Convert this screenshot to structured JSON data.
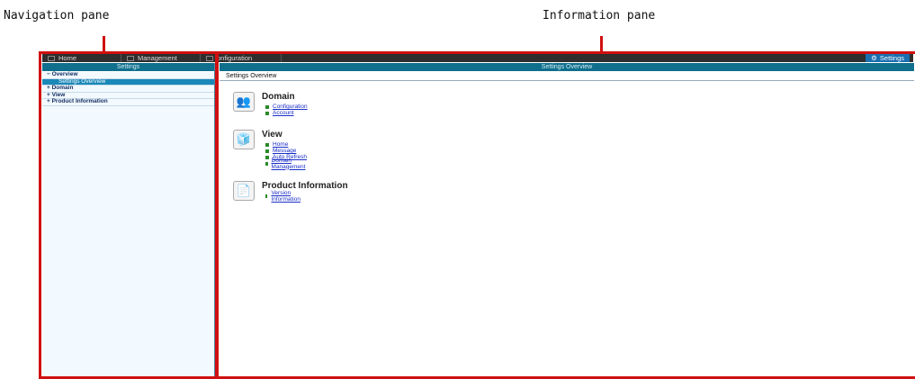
{
  "callouts": {
    "navigation_pane": "Navigation pane",
    "information_pane": "Information pane"
  },
  "topbar": {
    "tabs": [
      {
        "label": "Home",
        "icon": "home-icon"
      },
      {
        "label": "Management",
        "icon": "management-icon"
      },
      {
        "label": "onfiguration",
        "icon": "configuration-icon"
      }
    ],
    "settings_tab": "Settings"
  },
  "nav": {
    "header": "Settings",
    "tree": [
      {
        "label": "− Overview"
      },
      {
        "label": "Settings Overview",
        "selected": true
      },
      {
        "label": "+ Domain"
      },
      {
        "label": "+ View"
      },
      {
        "label": "+ Product Information"
      }
    ]
  },
  "info": {
    "header": "Settings Overview",
    "breadcrumb": "Settings Overview",
    "sections": [
      {
        "title": "Domain",
        "icon": "domain-icon",
        "links": [
          "Configuration",
          "Account"
        ]
      },
      {
        "title": "View",
        "icon": "view-icon",
        "links": [
          "Home",
          "Message",
          "Auto Refresh",
          "Domain Management"
        ]
      },
      {
        "title": "Product Information",
        "icon": "product-information-icon",
        "links": [
          "Version Information"
        ]
      }
    ]
  },
  "colors": {
    "callout_red": "#d01010",
    "topbar_dark": "#2e2e2e",
    "header_teal": "#0f6f8c",
    "selected_blue": "#1a88b8",
    "link_blue": "#1a2fc7"
  }
}
